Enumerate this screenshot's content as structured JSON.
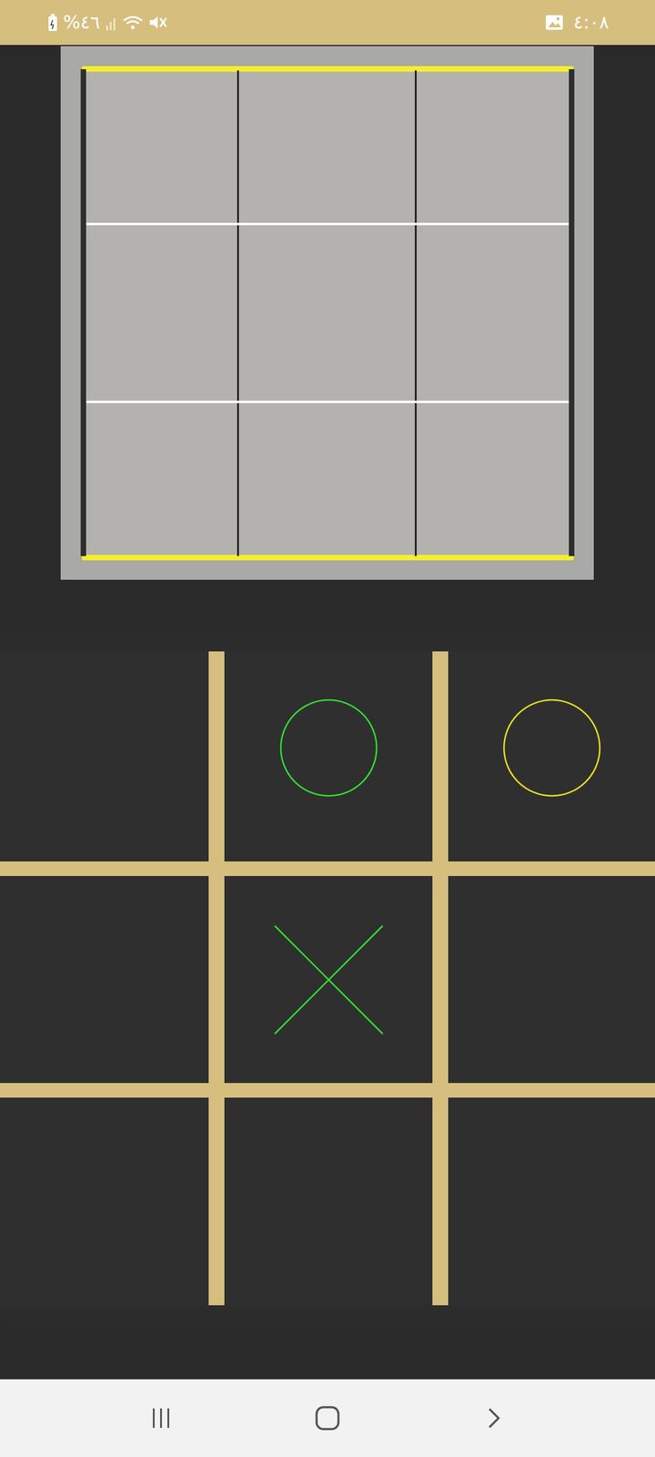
{
  "status_bar": {
    "battery": "%٤٦",
    "time": "٤:٠٨"
  },
  "board": [
    [
      {
        "kind": "empty",
        "color": "#000000"
      },
      {
        "kind": "o",
        "color": "#33dd33"
      },
      {
        "kind": "o",
        "color": "#e8e020"
      }
    ],
    [
      {
        "kind": "empty",
        "color": "#000000"
      },
      {
        "kind": "x",
        "color": "#33dd33"
      },
      {
        "kind": "empty",
        "color": "#000000"
      }
    ],
    [
      {
        "kind": "empty",
        "color": "#000000"
      },
      {
        "kind": "empty",
        "color": "#000000"
      },
      {
        "kind": "empty",
        "color": "#000000"
      }
    ]
  ]
}
